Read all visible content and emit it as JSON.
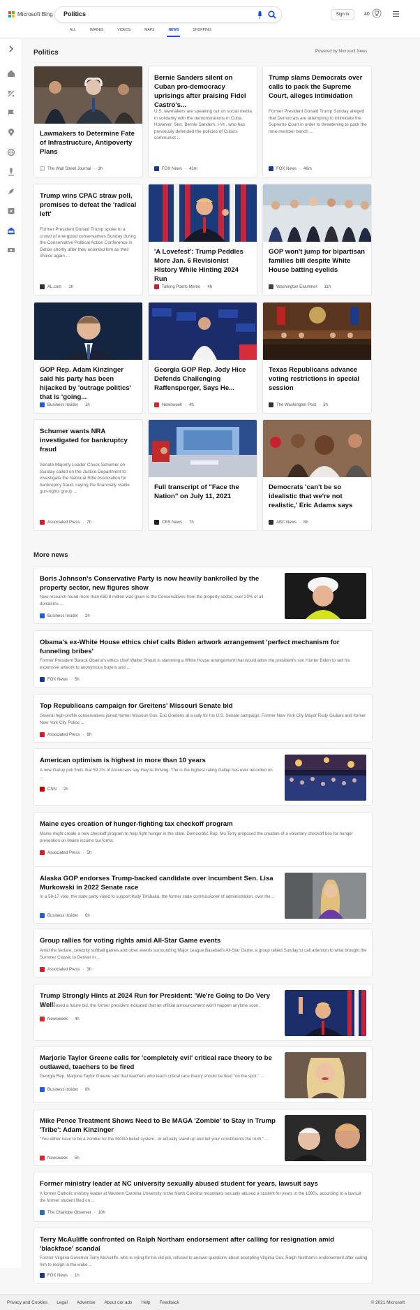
{
  "header": {
    "brand": "Microsoft Bing",
    "query": "Politics",
    "signin_label": "Sign in",
    "rewards_count": "40",
    "tabs": [
      "ALL",
      "IMAGES",
      "VIDEOS",
      "MAPS",
      "NEWS",
      "SHOPPING"
    ],
    "active_tab": "NEWS"
  },
  "main": {
    "section_title": "Politics",
    "powered_by": "Powered by Microsoft News",
    "cards": [
      {
        "title": "Lawmakers to Determine Fate of Infrastructure, Antipoverty Plans",
        "snippet": "",
        "source": "The Wall Street Journal",
        "time": "3h",
        "has_image": true,
        "image_bottom": false
      },
      {
        "title": "Bernie Sanders silent on Cuban pro-democracy uprisings after praising Fidel Castro's...",
        "snippet": "U.S. lawmakers are speaking out on social media in solidarity with the demonstrations in Cuba. However, Sen. Bernie Sanders, I-Vt., who has previously defended the policies of Cuba's communist ...",
        "source": "FOX News",
        "time": "43m",
        "has_image": false
      },
      {
        "title": "Trump slams Democrats over calls to pack the Supreme Court, alleges intimidation",
        "snippet": "Former President Donald Trump Sunday alleged that Democrats are attempting to intimidate the Supreme Court in order to threatening to pack the nine-member bench ...",
        "source": "FOX News",
        "time": "46m",
        "has_image": false
      },
      {
        "title": "Trump wins CPAC straw poll, promises to defeat the 'radical left'",
        "snippet": "Former President Donald Trump spoke to a crowd of energized conservatives Sunday during the Conservative Political Action Conference in Dallas shortly after they anointed him as their choice again ...",
        "source": "AL.com",
        "time": "1h",
        "has_image": false
      },
      {
        "title": "'A Lovefest': Trump Peddles More Jan. 6 Revisionist History While Hinting 2024 Run",
        "snippet": "",
        "source": "Talking Points Memo",
        "time": "4h",
        "has_image": true
      },
      {
        "title": "GOP won't jump for bipartisan families bill despite White House batting eyelids",
        "snippet": "",
        "source": "Washington Examiner",
        "time": "11h",
        "has_image": true
      },
      {
        "title": "GOP Rep. Adam Kinzinger said his party has been hijacked by 'outrage politics' that is 'going...",
        "snippet": "",
        "source": "Business Insider",
        "time": "1h",
        "has_image": true
      },
      {
        "title": "Georgia GOP Rep. Jody Hice Defends Challenging Raffensperger, Says He...",
        "snippet": "",
        "source": "Newsweek",
        "time": "4h",
        "has_image": true
      },
      {
        "title": "Texas Republicans advance voting restrictions in special session",
        "snippet": "",
        "source": "The Washington Post",
        "time": "3h",
        "has_image": true
      },
      {
        "title": "Schumer wants NRA investigated for bankruptcy fraud",
        "snippet": "Senate Majority Leader Chuck Schumer on Sunday called on the Justice Department to investigate the National Rifle Association for bankruptcy fraud, saying the financially stable gun-rights group ...",
        "source": "Associated Press",
        "time": "7h",
        "has_image": false
      },
      {
        "title": "Full transcript of \"Face the Nation\" on July 11, 2021",
        "snippet": "",
        "source": "CBS News",
        "time": "7h",
        "has_image": true
      },
      {
        "title": "Democrats 'can't be so idealistic that we're not realistic,' Eric Adams says",
        "snippet": "",
        "source": "ABC News",
        "time": "8h",
        "has_image": true
      }
    ],
    "more_news_title": "More news",
    "more_news": [
      {
        "title": "Boris Johnson's Conservative Party is now heavily bankrolled by the property sector, new figures show",
        "snippet": "New research found more than £60.8 million was given to the Conservatives from the property sector, over 20% of all donations ...",
        "source": "Business Insider",
        "time": "2h",
        "has_image": true
      },
      {
        "title": "Obama's ex-White House ethics chief calls Biden artwork arrangement 'perfect mechanism for funneling bribes'",
        "snippet": "Former President Barack Obama's ethics chief Walter Shaub is slamming a White House arrangement that would allow the president's son Hunter Biden to sell his expensive artwork to anonymous buyers and ...",
        "source": "FOX News",
        "time": "5h",
        "has_image": false
      },
      {
        "title": "Top Republicans campaign for Greitens' Missouri Senate bid",
        "snippet": "Several high-profile conservatives joined former Missouri Gov. Eric Greitens at a rally for his U.S. Senate campaign. Former New York City Mayor Rudy Giuliani and former New York City Police ...",
        "source": "Associated Press",
        "time": "6h",
        "has_image": false
      },
      {
        "title": "American optimism is highest in more than 10 years",
        "snippet": "A new Gallup poll finds that 59.2% of Americans say they're thriving. The is the highest rating Gallup has ever recorded on ...",
        "source": "CNN",
        "time": "2h",
        "has_image": true
      },
      {
        "title": "Maine eyes creation of hunger-fighting tax checkoff program",
        "snippet": "Maine might create a new checkoff program to help fight hunger in the state. Democratic Rep. Mo Terry proposed the creation of a voluntary checkoff box for hunger prevention on Maine income tax forms.",
        "source": "Associated Press",
        "time": "5h",
        "has_image": false
      },
      {
        "title": "Alaska GOP endorses Trump-backed candidate over incumbent Sen. Lisa Murkowski in 2022 Senate race",
        "snippet": "In a 58-17 vote, the state party voted to support Kelly Tshibaka, the former state commissioner of administration, over the ...",
        "source": "Business Insider",
        "time": "6h",
        "has_image": true
      },
      {
        "title": "Group rallies for voting rights amid All-Star Game events",
        "snippet": "Amid the fanfare, celebrity softball games and other events surrounding Major League Baseball's All-Star Game, a group rallied Sunday to call attention to what brought the Summer Classic to Denver in ...",
        "source": "Associated Press",
        "time": "3h",
        "has_image": false
      },
      {
        "title": "Trump Strongly Hints at 2024 Run for President: 'We're Going to Do Very Well'",
        "snippet": "As he teased a future bid, the former president indicated that an official announcement won't happen anytime soon.",
        "source": "Newsweek",
        "time": "4h",
        "has_image": true
      },
      {
        "title": "Marjorie Taylor Greene calls for 'completely evil' critical race theory to be outlawed, teachers to be fired",
        "snippet": "Georgia Rep. Marjorie Taylor Greene said that teachers who teach critical race theory should be fired \"on the spot.\" ...",
        "source": "Business Insider",
        "time": "8h",
        "has_image": true
      },
      {
        "title": "Mike Pence Treatment Shows Need to Be MAGA 'Zombie' to Stay in Trump 'Tribe': Adam Kinzinger",
        "snippet": "\"You either have to be a zombie for the MAGA belief system...or actually stand up and tell your constituents the truth,\" ...",
        "source": "Newsweek",
        "time": "5h",
        "has_image": true
      },
      {
        "title": "Former ministry leader at NC university sexually abused student for years, lawsuit says",
        "snippet": "A former Catholic ministry leader at Western Carolina University in the North Carolina mountains sexually abused a student for years in the 1980s, according to a lawsuit the former student filed on ...",
        "source": "The Charlotte Observer",
        "time": "10h",
        "has_image": false
      },
      {
        "title": "Terry McAuliffe confronted on Ralph Northam endorsement after calling for resignation amid 'blackface' scandal",
        "snippet": "Former Virginia Governor Terry McAuliffe, who is vying for his old job, refused to answer questions about accepting Virginia Gov. Ralph Northam's endorsement after calling him to resign in the wake ...",
        "source": "FOX News",
        "time": "1h",
        "has_image": false
      }
    ]
  },
  "footer": {
    "links": [
      "Privacy and Cookies",
      "Legal",
      "Advertise",
      "About our ads",
      "Help",
      "Feedback"
    ],
    "copyright": "© 2021 Microsoft"
  },
  "colors": {
    "accent": "#174ae4",
    "fox": "#1b3a8f",
    "newsweek": "#e0262b",
    "cnn": "#cc0000",
    "bi": "#1e5ee6",
    "ap": "#e11a22"
  }
}
